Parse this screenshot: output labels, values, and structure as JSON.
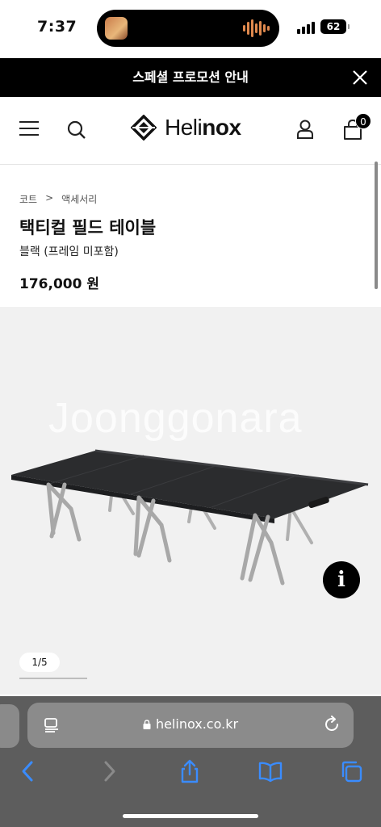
{
  "status": {
    "time": "7:37",
    "battery": "62"
  },
  "promo": {
    "text": "스페셜 프로모션 안내"
  },
  "header": {
    "brand_light": "Heli",
    "brand_bold": "nox",
    "cart_count": "0"
  },
  "product": {
    "breadcrumb": [
      "코트",
      ">",
      "액세서리"
    ],
    "title": "택티컬 필드 테이블",
    "subtitle": "블랙 (프레임 미포함)",
    "price": "176,000 원"
  },
  "gallery": {
    "watermark": "Joonggonara",
    "info_label": "i",
    "pager": "1/5"
  },
  "browser": {
    "url": "helinox.co.kr",
    "accent_color": "#3a8cff"
  }
}
